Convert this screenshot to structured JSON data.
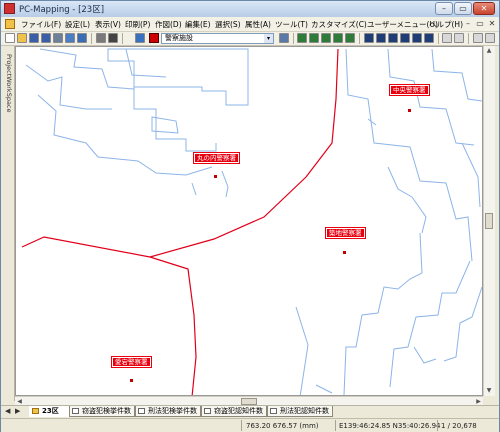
{
  "window": {
    "title": "PC-Mapping - [23区]",
    "min_glyph": "–",
    "restore_glyph": "▭",
    "close_glyph": "✕"
  },
  "menu": {
    "items": [
      "ファイル(F)",
      "設定(L)",
      "表示(V)",
      "印刷(P)",
      "作図(D)",
      "編集(E)",
      "選択(S)",
      "属性(A)",
      "ツール(T)",
      "カスタマイズ(C)",
      "ユーザーメニュー(U)",
      "ヘルプ(H)"
    ],
    "mdi_minimize": "–",
    "mdi_restore": "▭",
    "mdi_close": "✕"
  },
  "toolbar": {
    "layer_select_value": "警察施設",
    "select_arrow": "▾"
  },
  "side_panel": {
    "label": "ProjectWorkSpace"
  },
  "map": {
    "labels": [
      {
        "text": "中央警察署"
      },
      {
        "text": "丸の内警察署"
      },
      {
        "text": "築地警察署"
      },
      {
        "text": "愛宕警察署"
      }
    ]
  },
  "scroll": {
    "up": "▲",
    "down": "▼",
    "left": "◀",
    "right": "▶"
  },
  "tabs": {
    "nav_left": "◀",
    "nav_right": "▶",
    "items": [
      {
        "label": "23区",
        "active": true
      },
      {
        "label": "窃盗犯検挙件数",
        "active": false
      },
      {
        "label": "刑法犯検挙件数",
        "active": false
      },
      {
        "label": "窃盗犯認知件数",
        "active": false
      },
      {
        "label": "刑法犯認知件数",
        "active": false
      }
    ]
  },
  "status": {
    "coords_mm": "763.20 676.57 (mm)",
    "latlon": "E139:46:24.85 N35:40:26.94",
    "scale": "1 / 20,678"
  },
  "colors": {
    "boundary": "#e0001a",
    "coastline": "#8db4e8",
    "label_bg": "#e8000f"
  }
}
